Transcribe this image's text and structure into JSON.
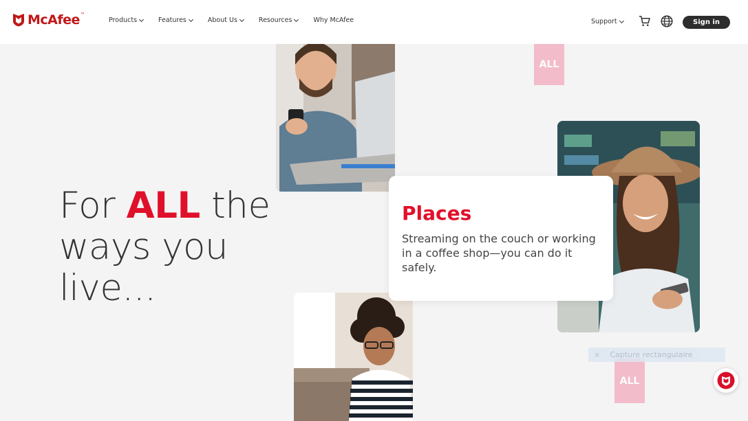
{
  "header": {
    "brand": "McAfee",
    "brand_tm": "™",
    "nav": [
      {
        "label": "Products",
        "has_dropdown": true
      },
      {
        "label": "Features",
        "has_dropdown": true
      },
      {
        "label": "About Us",
        "has_dropdown": true
      },
      {
        "label": "Resources",
        "has_dropdown": true
      },
      {
        "label": "Why McAfee",
        "has_dropdown": false
      }
    ],
    "support_label": "Support",
    "signin_label": "Sign in",
    "icons": {
      "logo": "mcafee-shield-icon",
      "cart": "cart-icon",
      "globe": "globe-icon",
      "chat": "mcafee-chat-icon"
    }
  },
  "hero": {
    "line1_before": "For ",
    "line1_accent": "ALL",
    "line1_after": " the",
    "line2": "ways you",
    "line3": "live..."
  },
  "card": {
    "title": "Places",
    "body": "Streaming on the couch or working in a coffee shop—you can do it safely."
  },
  "overlay": {
    "tag_top": "ALL",
    "tag_bottom": "ALL",
    "capture_close": "×",
    "capture_label": "Capture rectangulaire"
  },
  "colors": {
    "brand_red": "#c01818",
    "accent_red": "#e0102b",
    "text_dark": "#333333",
    "signin_bg": "#2d2d2d",
    "page_bg": "#f4f4f4"
  }
}
